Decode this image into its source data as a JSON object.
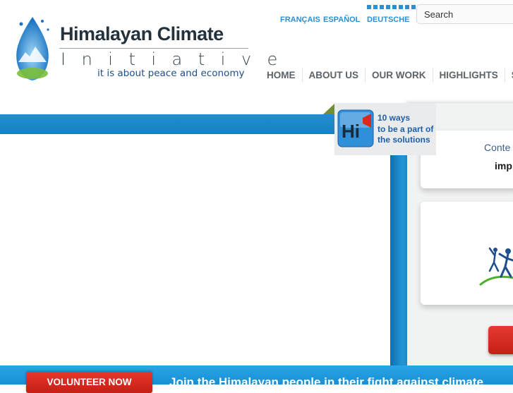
{
  "brand": {
    "title": "Himalayan Climate",
    "subtitle": "Initiative",
    "tagline": "it is about peace and economy"
  },
  "languages": [
    "FRANÇAIS",
    "ESPAÑOL",
    "DEUTSCHE"
  ],
  "search": {
    "value": "Search"
  },
  "nav": [
    "HOME",
    "ABOUT US",
    "OUR WORK",
    "HIGHLIGHTS",
    "S"
  ],
  "ways_box": {
    "icon_text": "Hi",
    "lines": [
      "10 ways",
      "to be a part of",
      "the solutions"
    ]
  },
  "right_panel": {
    "text1": "Conte",
    "text2": "imp"
  },
  "bottom": {
    "volunteer_label": "VOLUNTEER NOW",
    "join_text": "Join the Himalayan people in their fight against climate"
  },
  "colors": {
    "accent_blue": "#1e8fd0",
    "brand_dark": "#23323d",
    "cta_red": "#d92a20",
    "nav_text": "#5b6268"
  }
}
